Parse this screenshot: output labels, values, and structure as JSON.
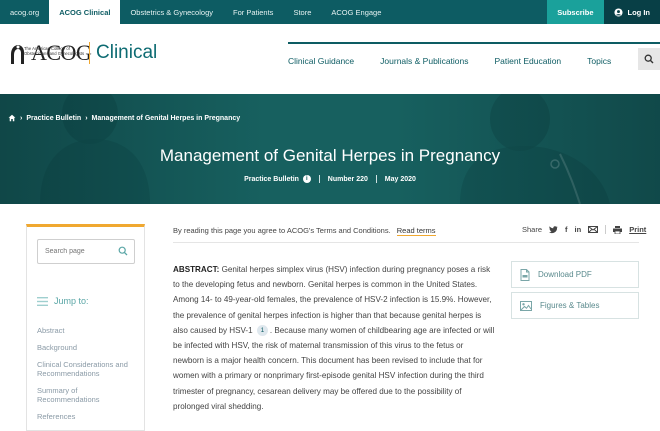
{
  "topbar": {
    "links": [
      "acog.org",
      "ACOG Clinical",
      "Obstetrics & Gynecology",
      "For Patients",
      "Store",
      "ACOG Engage"
    ],
    "subscribe": "Subscribe",
    "login": "Log In"
  },
  "header": {
    "logo_text": "ACOG",
    "logo_sub": "The American College of Obstetricians and Gynecologists",
    "clinical": "Clinical",
    "nav": [
      "Clinical Guidance",
      "Journals & Publications",
      "Patient Education",
      "Topics"
    ]
  },
  "hero": {
    "breadcrumb": [
      "Practice Bulletin",
      "Management of Genital Herpes in Pregnancy"
    ],
    "title": "Management of Genital Herpes in Pregnancy",
    "meta_type": "Practice Bulletin",
    "meta_number": "Number 220",
    "meta_date": "May 2020"
  },
  "sidebar": {
    "search_placeholder": "Search page",
    "jump_label": "Jump to:",
    "toc": [
      "Abstract",
      "Background",
      "Clinical Considerations and Recommendations",
      "Summary of Recommendations",
      "References"
    ]
  },
  "content": {
    "terms_text": "By reading this page you agree to ACOG's Terms and Conditions.",
    "read_terms": "Read terms",
    "share_label": "Share",
    "print_label": "Print",
    "abstract_label": "ABSTRACT:",
    "abstract_part1": "Genital herpes simplex virus (HSV) infection during pregnancy poses a risk to the developing fetus and newborn. Genital herpes is common in the United States. Among 14- to 49-year-old females, the prevalence of HSV-2 infection is 15.9%. However, the prevalence of genital herpes infection is higher than that because genital herpes is also caused by HSV-1",
    "ref_number": "1",
    "abstract_part2": ". Because many women of childbearing age are infected or will be infected with HSV, the risk of maternal transmission of this virus to the fetus or newborn is a major health concern. This document has been revised to include that for women with a primary or nonprimary first-episode genital HSV infection during the third trimester of pregnancy, cesarean delivery may be offered due to the possibility of prolonged viral shedding."
  },
  "right_buttons": {
    "download_pdf": "Download PDF",
    "figures_tables": "Figures & Tables"
  },
  "colors": {
    "brand_teal": "#0d5c63",
    "hero_teal": "#17605f",
    "accent_orange": "#f0a830",
    "subscribe_teal": "#1aa19b"
  }
}
